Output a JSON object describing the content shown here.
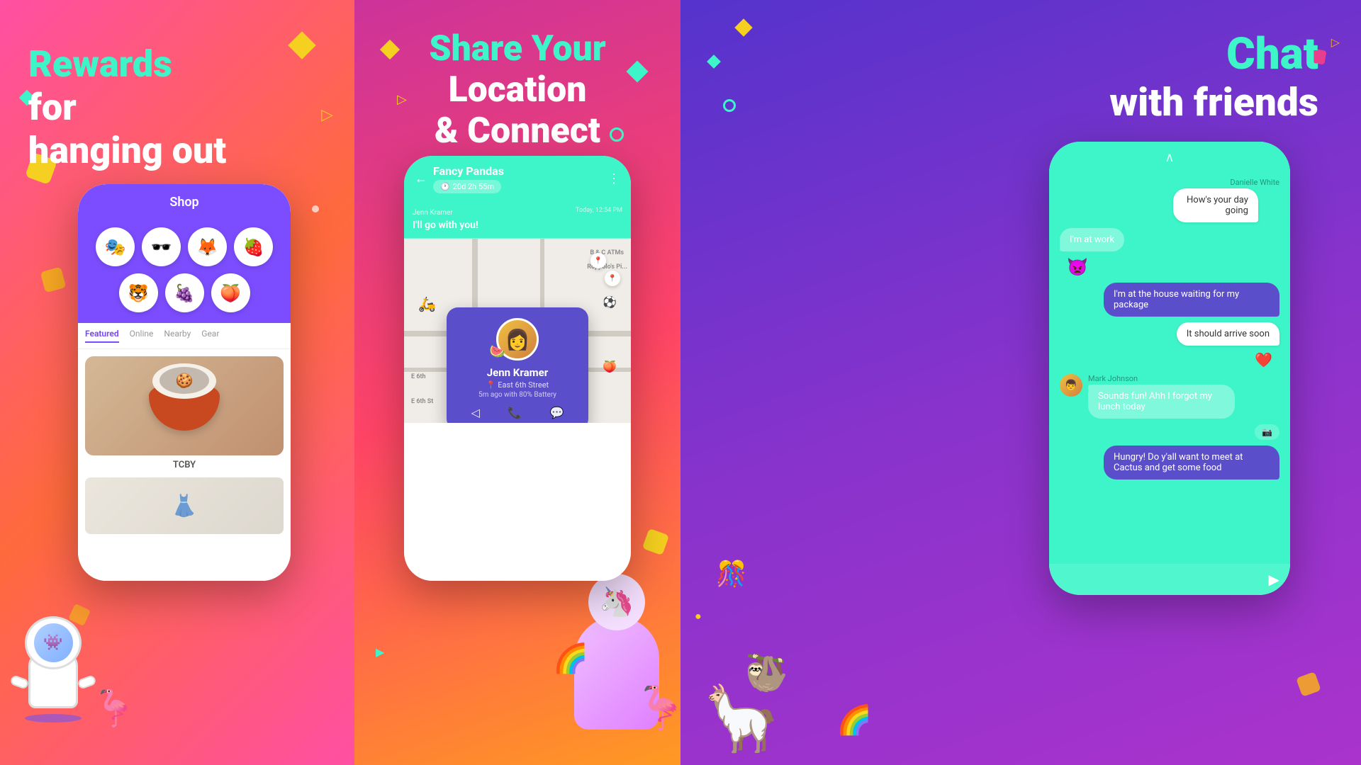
{
  "panel1": {
    "title_line1": "Rewards",
    "title_line2": "for",
    "title_line3": "hanging out",
    "phone": {
      "shop_label": "Shop",
      "tabs": [
        "Featured",
        "Online",
        "Nearby",
        "Gear"
      ],
      "active_tab": "Featured",
      "food_label": "TCBY",
      "avatars": [
        "🎭",
        "🕶️",
        "🦊",
        "🍓",
        "🐯",
        "🍇",
        "🍑"
      ]
    },
    "colors": {
      "gradient_start": "#e83e8c",
      "gradient_end": "#ff6347",
      "accent": "#3df5c8",
      "phone_purple": "#7c4dff"
    }
  },
  "panel2": {
    "title_line1": "Share Your",
    "title_line2": "Location",
    "title_line3": "& Connect",
    "phone": {
      "group_name": "Fancy Pandas",
      "timer": "20d 2h 55m",
      "chat_sender": "Jenn Kramer",
      "chat_time": "Today, 12:54 PM",
      "chat_message": "I'll go with you!",
      "user_name": "Jenn Kramer",
      "user_address": "East 6th Street",
      "user_battery": "5m ago with 80% Battery",
      "map_label1": "B & C ATMs",
      "map_label2": "Roppolo's Pi...",
      "map_label3": "E 6th",
      "map_label4": "E 6th St"
    }
  },
  "panel3": {
    "title_line1": "Chat",
    "title_line2": "with friends",
    "phone": {
      "messages": [
        {
          "sender": "Danielle White",
          "text": "How's your day going",
          "type": "right"
        },
        {
          "text": "I'm at work",
          "type": "left"
        },
        {
          "emoji": "👿",
          "type": "emoji"
        },
        {
          "text": "I'm at the house waiting for my package",
          "type": "right-dark"
        },
        {
          "text": "It should arrive soon",
          "type": "right"
        },
        {
          "sender": "Mark Johnson",
          "text": "Sounds fun! Ahh I forgot my lunch today",
          "type": "left-avatar"
        },
        {
          "text": "Hungry! Do y'all want to meet at Cactus and get some food",
          "type": "right-dark"
        }
      ]
    }
  }
}
